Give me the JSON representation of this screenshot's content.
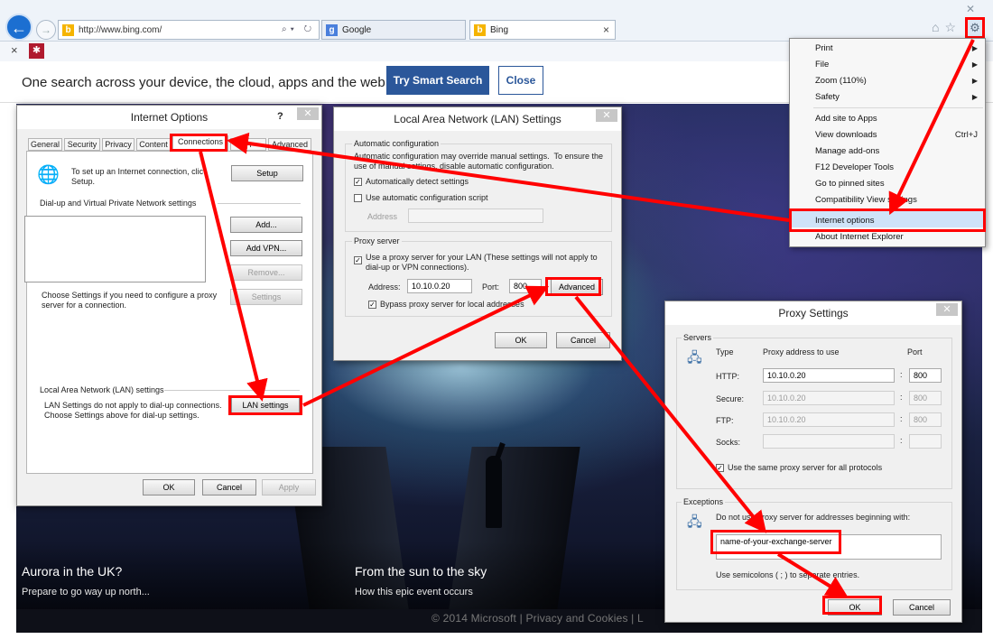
{
  "browser": {
    "url": "http://www.bing.com/",
    "tabs": [
      {
        "label": "Google",
        "icon": "google-icon"
      },
      {
        "label": "Bing",
        "icon": "bing-icon"
      }
    ],
    "tab_close": "×",
    "window_close": "✕"
  },
  "banner": {
    "message": "One search across your device, the cloud, apps and the web.",
    "try_label": "Try Smart Search",
    "close_label": "Close"
  },
  "hero": {
    "left_title": "Aurora in the UK?",
    "left_sub": "Prepare to go way up north...",
    "right_title": "From the sun to the sky",
    "right_sub": "How this epic event occurs",
    "footer": "© 2014 Microsoft  |  Privacy and Cookies  |  L"
  },
  "ie_menu": {
    "items": [
      {
        "label": "Print",
        "arrow": "▶"
      },
      {
        "label": "File",
        "arrow": "▶"
      },
      {
        "label": "Zoom (110%)",
        "arrow": "▶"
      },
      {
        "label": "Safety",
        "arrow": "▶"
      },
      {
        "label": "Add site to Apps"
      },
      {
        "label": "View downloads",
        "shortcut": "Ctrl+J"
      },
      {
        "label": "Manage add-ons"
      },
      {
        "label": "F12 Developer Tools"
      },
      {
        "label": "Go to pinned sites"
      },
      {
        "label": "Compatibility View settings"
      },
      {
        "label": "Internet options"
      },
      {
        "label": "About Internet Explorer"
      }
    ]
  },
  "internet_options": {
    "title": "Internet Options",
    "help": "?",
    "close": "✕",
    "tabs": [
      "General",
      "Security",
      "Privacy",
      "Content",
      "Connections",
      "Pr",
      "Advanced"
    ],
    "setup_text": "To set up an Internet connection, clic\nSetup.",
    "setup_button": "Setup",
    "dialup_heading": "Dial-up and Virtual Private Network settings",
    "add_button": "Add...",
    "add_vpn_button": "Add VPN...",
    "remove_button": "Remove...",
    "settings_button": "Settings",
    "choose_settings_text": "Choose Settings if you need to configure a proxy\nserver for a connection.",
    "lan_heading": "Local Area Network (LAN) settings",
    "lan_text": "LAN Settings do not apply to dial-up connections.\nChoose Settings above for dial-up settings.",
    "lan_button": "LAN settings",
    "ok": "OK",
    "cancel": "Cancel",
    "apply": "Apply"
  },
  "lan_settings": {
    "title": "Local Area Network (LAN) Settings",
    "close": "✕",
    "auto_heading": "Automatic configuration",
    "auto_text": "Automatic configuration may override manual settings.  To ensure the\nuse of manual settings, disable automatic configuration.",
    "auto_detect_label": "Automatically detect settings",
    "auto_detect_checked": true,
    "use_script_label": "Use automatic configuration script",
    "use_script_checked": false,
    "address_label": "Address",
    "proxy_heading": "Proxy server",
    "use_proxy_label": "Use a proxy server for your LAN (These settings will not apply to\ndial-up or VPN connections).",
    "use_proxy_checked": true,
    "proxy_address_label": "Address:",
    "proxy_address": "10.10.0.20",
    "port_label": "Port:",
    "port": "800",
    "advanced_button": "Advanced",
    "bypass_label": "Bypass proxy server for local addresses",
    "bypass_checked": true,
    "ok": "OK",
    "cancel": "Cancel"
  },
  "proxy_settings": {
    "title": "Proxy Settings",
    "close": "✕",
    "servers_heading": "Servers",
    "col_type": "Type",
    "col_address": "Proxy address to use",
    "col_port": "Port",
    "rows": [
      {
        "type": "HTTP:",
        "address": "10.10.0.20",
        "port": "800",
        "enabled": true
      },
      {
        "type": "Secure:",
        "address": "10.10.0.20",
        "port": "800",
        "enabled": false
      },
      {
        "type": "FTP:",
        "address": "10.10.0.20",
        "port": "800",
        "enabled": false
      },
      {
        "type": "Socks:",
        "address": "",
        "port": "",
        "enabled": false
      }
    ],
    "same_proxy_label": "Use the same proxy server for all protocols",
    "same_proxy_checked": true,
    "exceptions_heading": "Exceptions",
    "exceptions_text": "Do not use proxy server for addresses beginning with:",
    "exceptions_value": "name-of-your-exchange-server",
    "semicolons_text": "Use semicolons ( ; ) to separate entries.",
    "ok": "OK",
    "cancel": "Cancel"
  },
  "colors": {
    "highlight": "#ff0000",
    "ie_blue": "#1c6fd1",
    "bing_button": "#2b579a"
  }
}
